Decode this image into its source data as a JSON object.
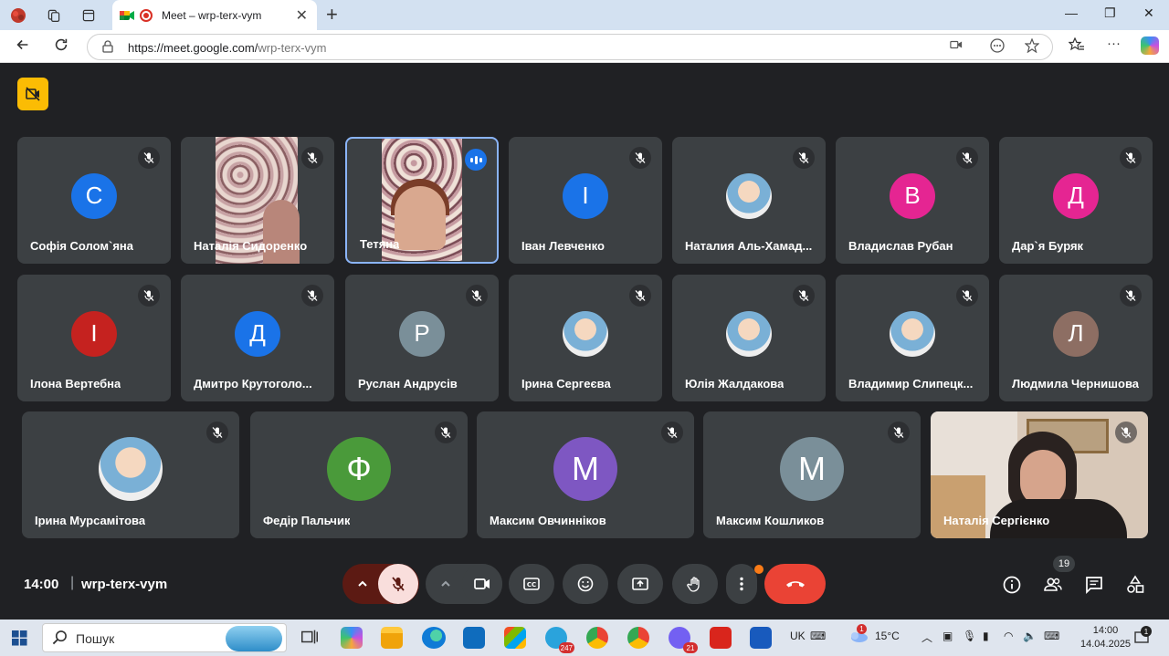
{
  "browser": {
    "tab_title": "Meet – wrp-terx-vym",
    "url_host": "https://meet.google.com/",
    "url_path": "wrp-terx-vym",
    "new_tab": "+",
    "close": "✕"
  },
  "meeting": {
    "time": "14:00",
    "separator": "|",
    "code": "wrp-terx-vym",
    "participant_count": "19"
  },
  "participants": [
    {
      "name": "Софія Солом`яна",
      "initial": "С",
      "color": "#1a73e8",
      "kind": "initial"
    },
    {
      "name": "Наталія Сидоренко",
      "kind": "video"
    },
    {
      "name": "Тетяна",
      "kind": "video-speaking"
    },
    {
      "name": "Іван Левченко",
      "initial": "І",
      "color": "#1a73e8",
      "kind": "initial"
    },
    {
      "name": "Наталия Аль-Хамад...",
      "kind": "photo"
    },
    {
      "name": "Владислав Рубан",
      "initial": "В",
      "color": "#e52592",
      "kind": "initial"
    },
    {
      "name": "Дар`я Буряк",
      "initial": "Д",
      "color": "#e52592",
      "kind": "initial"
    },
    {
      "name": "Ілона Вертебна",
      "initial": "І",
      "color": "#c5221f",
      "kind": "initial"
    },
    {
      "name": "Дмитро Крутоголо...",
      "initial": "Д",
      "color": "#1a73e8",
      "kind": "initial"
    },
    {
      "name": "Руслан Андрусів",
      "initial": "Р",
      "color": "#7a8f99",
      "kind": "initial"
    },
    {
      "name": "Ірина Сергеєва",
      "kind": "photo"
    },
    {
      "name": "Юлія Жалдакова",
      "kind": "photo"
    },
    {
      "name": "Владимир Слипецк...",
      "kind": "photo"
    },
    {
      "name": "Людмила Чернишова",
      "initial": "Л",
      "color": "#8d6e63",
      "kind": "initial"
    },
    {
      "name": "Ірина Мурсамітова",
      "kind": "photo"
    },
    {
      "name": "Федір Пальчик",
      "initial": "Ф",
      "color": "#4a9a3a",
      "kind": "initial"
    },
    {
      "name": "Максим Овчиннiков",
      "initial": "М",
      "color": "#7e57c2",
      "kind": "initial"
    },
    {
      "name": "Максим Кошликов",
      "initial": "М",
      "color": "#7a8f99",
      "kind": "initial"
    },
    {
      "name": "Наталія Сергієнко",
      "kind": "video"
    }
  ],
  "taskbar": {
    "search_placeholder": "Пошук",
    "lang": "UK",
    "weather": "15°C",
    "time": "14:00",
    "date": "14.04.2025",
    "telegram_badge": "247",
    "viber_badge": "21",
    "notif_badge": "1",
    "weather_badge": "1"
  },
  "colors": {
    "accent": "#1a73e8",
    "end_call": "#ea4335",
    "mic_off_bg": "#f9dedc",
    "mic_off_dark": "#5c1a13",
    "yellow": "#fbbc04"
  }
}
